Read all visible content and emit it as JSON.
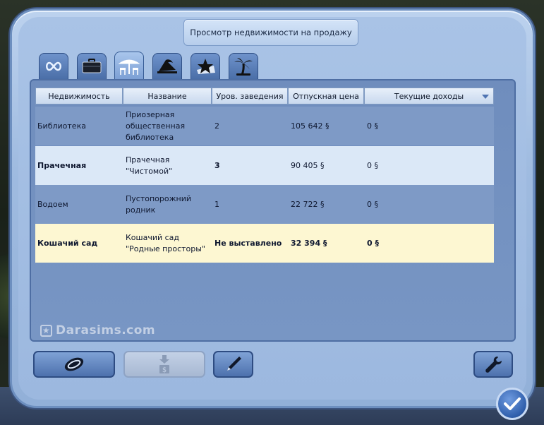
{
  "window": {
    "title": "Просмотр недвижимости на продажу"
  },
  "tabs": [
    {
      "icon": "infinity-icon"
    },
    {
      "icon": "briefcase-icon"
    },
    {
      "icon": "beach-cafe-icon"
    },
    {
      "icon": "island-icon"
    },
    {
      "icon": "star-icon"
    },
    {
      "icon": "palm-tree-icon"
    }
  ],
  "table": {
    "headers": [
      "Недвижимость",
      "Название",
      "Уров. заведения",
      "Отпускная цена",
      "Текущие доходы"
    ],
    "rows": [
      {
        "property": "Библиотека",
        "name": "Приозерная общественная библиотека",
        "level": "2",
        "price": "105 642 §",
        "income": "0 §"
      },
      {
        "property": "Прачечная",
        "name": "Прачечная \"Чистомой\"",
        "level": "3",
        "price": "90 405 §",
        "income": "0 §"
      },
      {
        "property": "Водоем",
        "name": "Пустопорожний родник",
        "level": "1",
        "price": "22 722 §",
        "income": "0 §"
      },
      {
        "property": "Кошачий сад",
        "name": "Кошачий сад \"Родные просторы\"",
        "level": "Не выставлено",
        "price": "32 394 §",
        "income": "0 §"
      }
    ]
  },
  "watermark": {
    "text": "Darasims.com"
  },
  "buttons": {
    "left": {
      "icon": "coin-icon"
    },
    "sell": {
      "icon": "sell-sign-icon",
      "disabled": true
    },
    "edit": {
      "icon": "pen-icon"
    },
    "tools": {
      "icon": "wrench-icon"
    },
    "confirm": {
      "icon": "checkmark-icon"
    }
  },
  "colors": {
    "row_selected": "#dbe8f7",
    "row_highlight": "#fdf7d2",
    "row_default": "#7e9ac6",
    "header_bg": "#e8f0fa"
  }
}
